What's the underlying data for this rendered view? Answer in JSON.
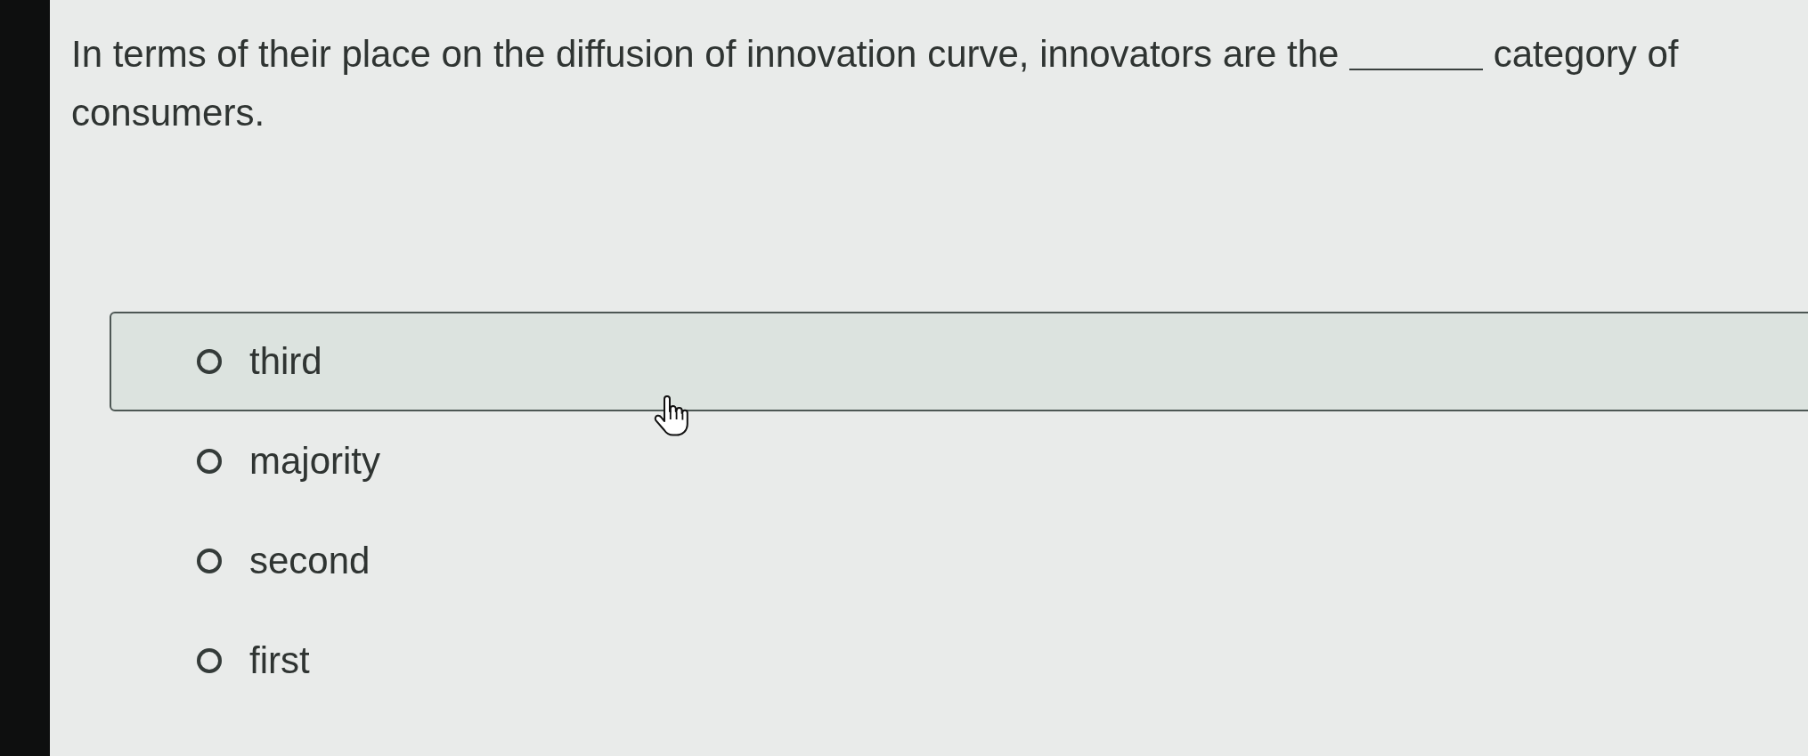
{
  "question": {
    "parts": [
      {
        "kind": "text",
        "text": "In terms of their place on the diffusion of innovation curve, innovators are the"
      },
      {
        "kind": "blank"
      },
      {
        "kind": "text",
        "text": "category of consumers."
      }
    ]
  },
  "options": [
    {
      "label": "third",
      "selected": false,
      "highlighted": true
    },
    {
      "label": "majority",
      "selected": false,
      "highlighted": false
    },
    {
      "label": "second",
      "selected": false,
      "highlighted": false
    },
    {
      "label": "first",
      "selected": false,
      "highlighted": false
    }
  ]
}
